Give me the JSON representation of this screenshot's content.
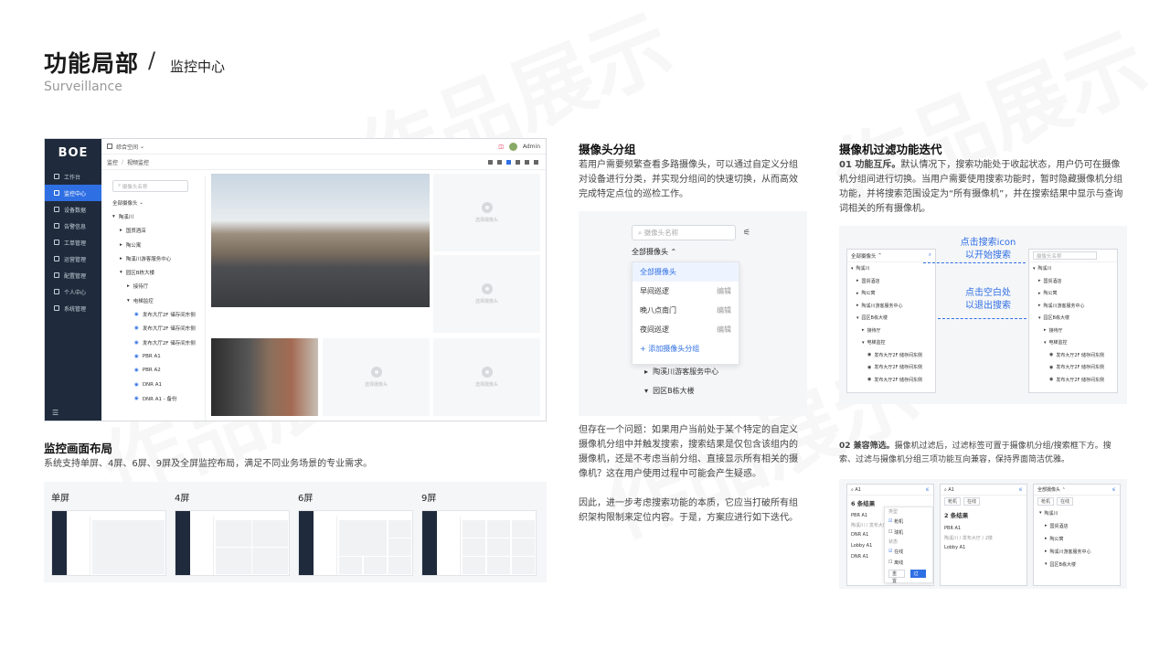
{
  "header": {
    "title": "功能局部",
    "separator": "/",
    "subtitle": "监控中心",
    "english": "Surveillance"
  },
  "app": {
    "logo": "BOE",
    "nav": [
      "工作台",
      "监控中心",
      "设备数据",
      "告警信息",
      "工单管理",
      "运营管理",
      "配置管理",
      "个人中心",
      "系统管理"
    ],
    "topbar": {
      "workspace": "综合空间",
      "user": "Admin"
    },
    "breadcrumb": {
      "parent": "监控",
      "current": "视频监控"
    },
    "tree": {
      "search_placeholder": "摄像头名称",
      "group": "全部摄像头",
      "items": [
        "陶溪川",
        "国贸酒店",
        "陶公寓",
        "陶溪川游客服务中心",
        "园区B栋大楼",
        "接待厅",
        "电梯监控",
        "发布大厅2F 储存间东侧",
        "发布大厅2F 储存间东侧",
        "发布大厅2F 储存间东侧",
        "PBR A1",
        "PBR A2",
        "DNR A1",
        "DNR A1 - 备份"
      ]
    },
    "empty_label": "选择摄像头"
  },
  "layout_section": {
    "title": "监控画面布局",
    "desc": "系统支持单屏、4屏、6屏、9屏及全屏监控布局，满足不同业务场景的专业需求。",
    "thumbs": [
      {
        "label": "单屏"
      },
      {
        "label": "4屏"
      },
      {
        "label": "6屏"
      },
      {
        "label": "9屏"
      }
    ]
  },
  "group_section": {
    "title": "摄像头分组",
    "desc": "若用户需要频繁查看多路摄像头，可以通过自定义分组对设备进行分类，并实现分组间的快速切换，从而高效完成特定点位的巡检工作。",
    "search_placeholder": "摄像头名称",
    "head": "全部摄像头",
    "menu": [
      {
        "label": "全部摄像头",
        "edit": ""
      },
      {
        "label": "早间巡逻",
        "edit": "编辑"
      },
      {
        "label": "晚八点南门",
        "edit": "编辑"
      },
      {
        "label": "夜间巡逻",
        "edit": "编辑"
      }
    ],
    "add": "+ 添加摄像头分组",
    "tree_below": [
      "陶溪川游客服务中心",
      "园区B栋大楼"
    ],
    "p2": "但存在一个问题：如果用户当前处于某个特定的自定义摄像机分组中并触发搜索，搜索结果是仅包含该组内的摄像机，还是不考虑当前分组、直接显示所有相关的摄像机？这在用户使用过程中可能会产生疑惑。",
    "p3": "因此，进一步考虑搜索功能的本质，它应当打破所有组织架构限制来定位内容。于是，方案应进行如下迭代。"
  },
  "filter_section": {
    "title": "摄像机过滤功能迭代",
    "p1_bold": "01 功能互斥。",
    "p1": "默认情况下，搜索功能处于收起状态，用户仍可在摄像机分组间进行切换。当用户需要使用搜索功能时，暂时隐藏摄像机分组功能，并将搜索范围设定为“所有摄像机”，并在搜索结果中显示与查询词相关的所有摄像机。",
    "anno1": "点击搜索icon",
    "anno1b": "以开始搜索",
    "anno2": "点击空白处",
    "anno2b": "以退出搜索",
    "panel_head": "全部摄像头",
    "panel_search": "摄像头名称",
    "panel_items": [
      "陶溪川",
      "国贸酒店",
      "陶公寓",
      "陶溪川游客服务中心",
      "园区B栋大楼",
      "接待厅",
      "电梯监控",
      "发布大厅2F 储存间东侧",
      "发布大厅2F 储存间东侧",
      "发布大厅2F 储存间东侧"
    ],
    "p2_bold": "02 兼容筛选。",
    "p2": "摄像机过滤后，过滤标签可置于摄像机分组/搜索框下方。搜索、过滤与摄像机分组三项功能互向兼容，保持界面简洁优雅。",
    "c1": {
      "query": "A1",
      "count": "6 条结果",
      "items": [
        "PBR A1",
        "DNR A1",
        "Lobby A1",
        "DNR A1"
      ],
      "sub": "陶溪川 / 发布大厅",
      "opts": [
        "枪机",
        "球机",
        "在线",
        "离线"
      ],
      "type_label": "类型",
      "state_label": "状态",
      "reset": "重置",
      "ok": "过滤"
    },
    "c2": {
      "query": "A1",
      "chips": [
        "枪机",
        "在线"
      ],
      "count": "2 条结果",
      "items": [
        "PBR A1",
        "Lobby A1"
      ],
      "sub": "陶溪川 / 发布大厅 / 2楼"
    },
    "c3": {
      "head": "全部摄像头",
      "chips": [
        "枪机",
        "在线"
      ],
      "items": [
        "陶溪川",
        "国贸酒店",
        "陶公寓",
        "陶溪川游客服务中心",
        "园区B栋大楼"
      ]
    }
  }
}
